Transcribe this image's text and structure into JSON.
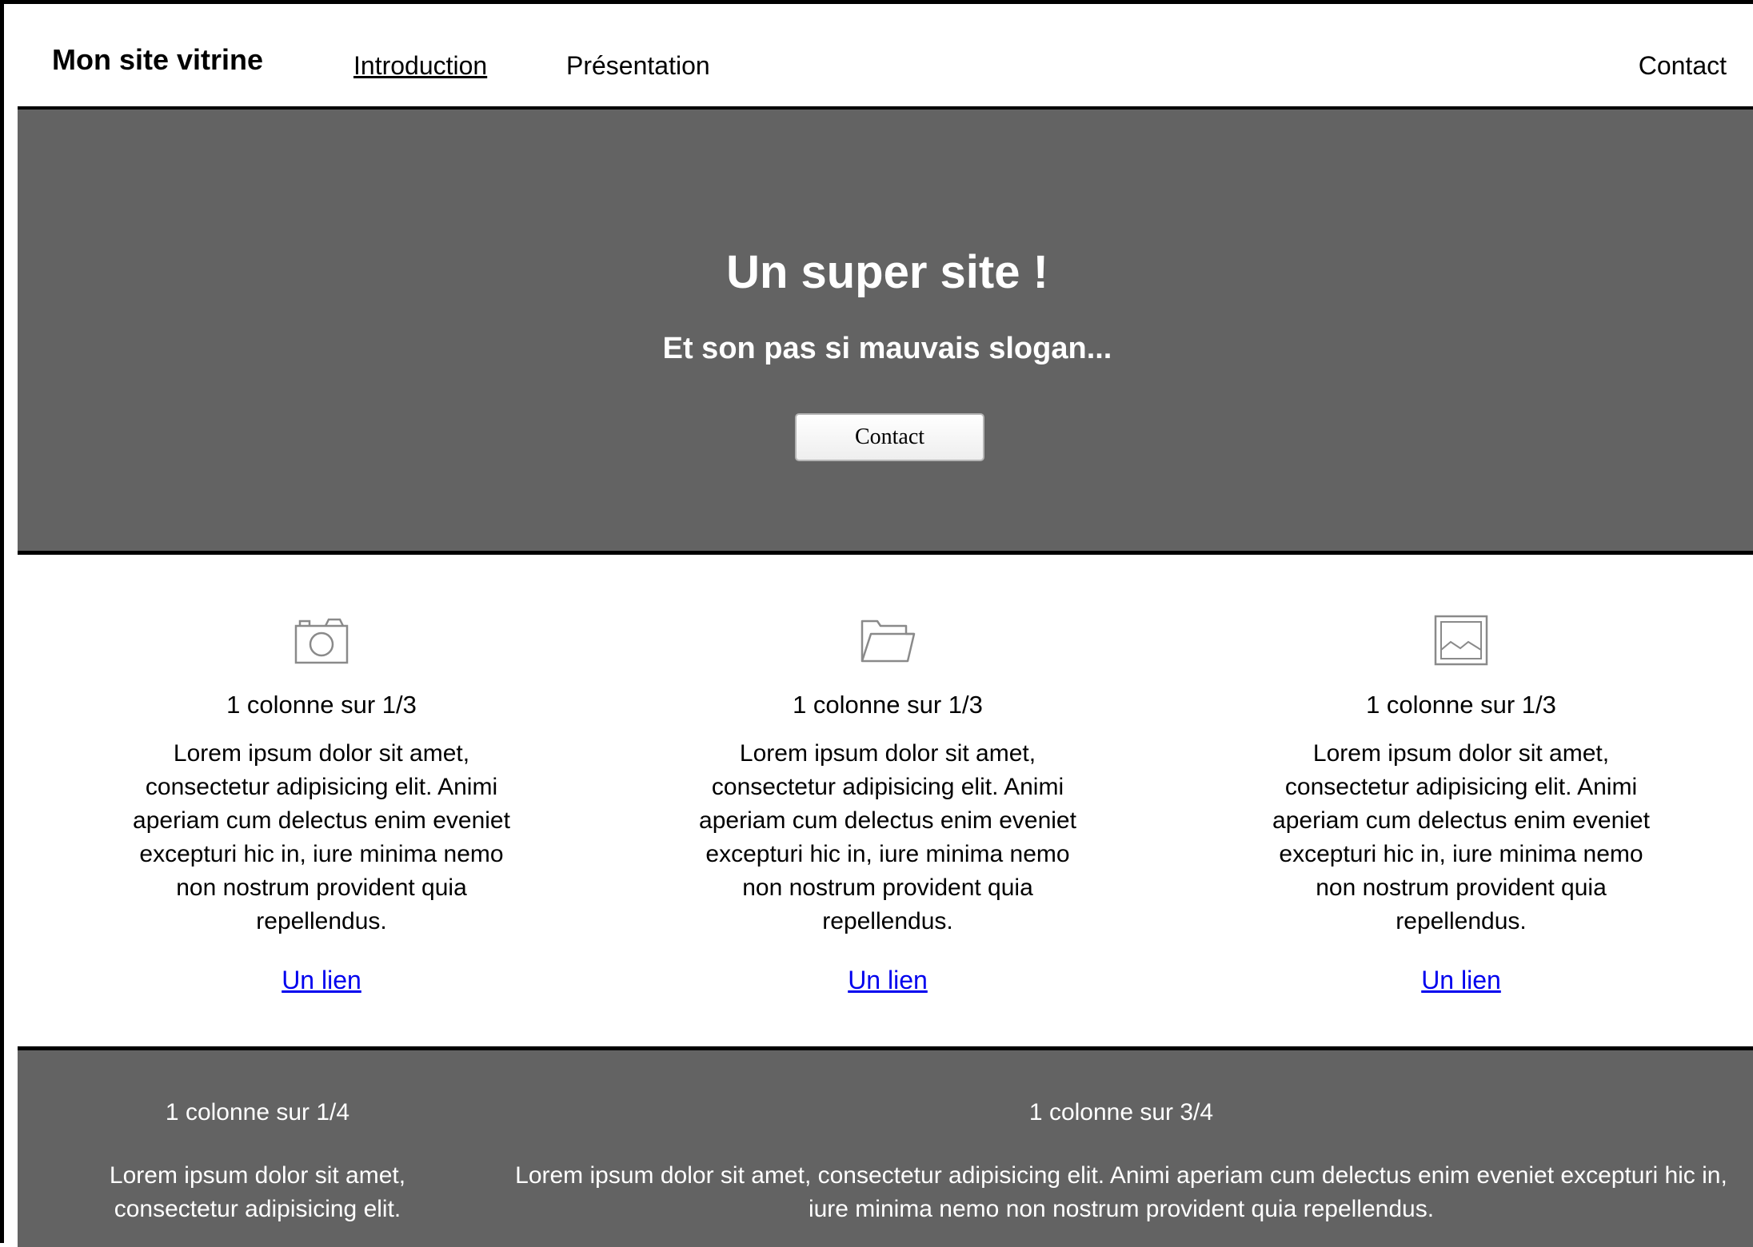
{
  "nav": {
    "brand": "Mon site vitrine",
    "links": [
      {
        "label": "Introduction",
        "active": true
      },
      {
        "label": "Présentation",
        "active": false
      }
    ],
    "contact": "Contact"
  },
  "hero": {
    "title": "Un super site !",
    "slogan": "Et son pas si mauvais slogan...",
    "button": "Contact"
  },
  "features": [
    {
      "icon": "camera-icon",
      "title": "1 colonne sur 1/3",
      "text": "Lorem ipsum dolor sit amet, consectetur adipisicing elit. Animi aperiam cum delectus enim eveniet excepturi hic in, iure minima nemo non nostrum provident quia repellendus.",
      "link": "Un lien"
    },
    {
      "icon": "folder-icon",
      "title": "1 colonne sur 1/3",
      "text": "Lorem ipsum dolor sit amet, consectetur adipisicing elit. Animi aperiam cum delectus enim eveniet excepturi hic in, iure minima nemo non nostrum provident quia repellendus.",
      "link": "Un lien"
    },
    {
      "icon": "image-icon",
      "title": "1 colonne sur 1/3",
      "text": "Lorem ipsum dolor sit amet, consectetur adipisicing elit. Animi aperiam cum delectus enim eveniet excepturi hic in, iure minima nemo non nostrum provident quia repellendus.",
      "link": "Un lien"
    }
  ],
  "footer": {
    "left": {
      "title": "1 colonne sur 1/4",
      "text": "Lorem ipsum dolor sit amet, consectetur adipisicing elit."
    },
    "right": {
      "title": "1 colonne sur 3/4",
      "text": "Lorem ipsum dolor sit amet, consectetur adipisicing elit. Animi aperiam cum delectus enim eveniet excepturi hic in, iure minima nemo non nostrum provident quia repellendus."
    }
  },
  "colors": {
    "dark_band": "#636363",
    "link": "#0000ee"
  }
}
